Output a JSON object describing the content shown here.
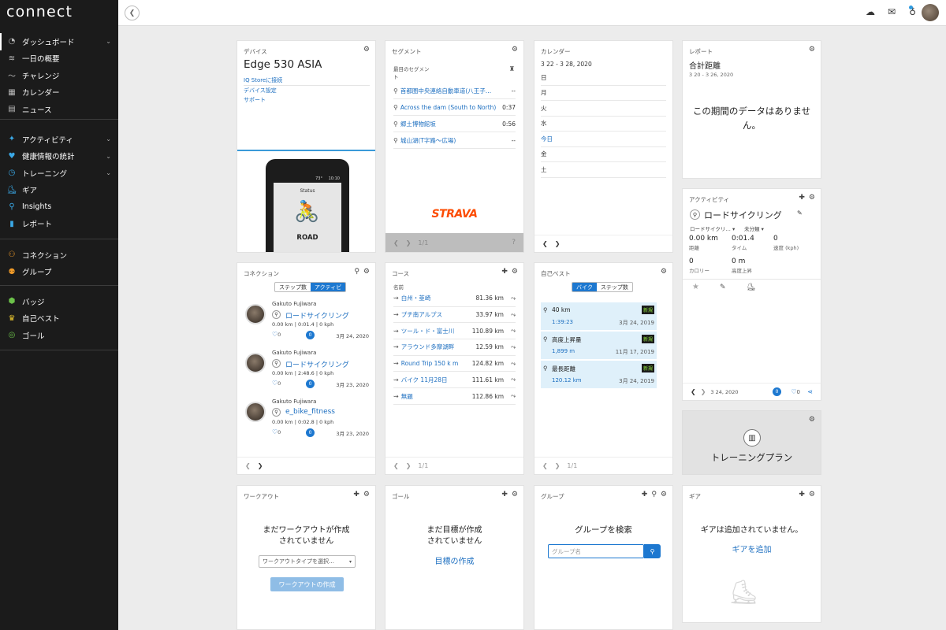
{
  "app": {
    "logo": "connect"
  },
  "sidebar": {
    "group1": [
      {
        "label": "ダッシュボード",
        "icon": "dashboard-icon",
        "glyph": "◔",
        "chevron": true
      },
      {
        "label": "一日の概要",
        "icon": "layers-icon",
        "glyph": "≋",
        "chevron": false
      },
      {
        "label": "チャレンジ",
        "icon": "challenge-icon",
        "glyph": "〜",
        "chevron": false
      },
      {
        "label": "カレンダー",
        "icon": "calendar-icon",
        "glyph": "▦",
        "chevron": false
      },
      {
        "label": "ニュース",
        "icon": "news-icon",
        "glyph": "▤",
        "chevron": false
      }
    ],
    "group2": [
      {
        "label": "アクティビティ",
        "icon": "activity-icon",
        "glyph": "✦",
        "chevron": true,
        "color": "blue"
      },
      {
        "label": "健康情報の統計",
        "icon": "heart-icon",
        "glyph": "♥",
        "chevron": true,
        "color": "blue"
      },
      {
        "label": "トレーニング",
        "icon": "stopwatch-icon",
        "glyph": "◷",
        "chevron": true,
        "color": "blue"
      },
      {
        "label": "ギア",
        "icon": "shoe-icon",
        "glyph": "⛸",
        "chevron": false,
        "color": "blue"
      },
      {
        "label": "Insights",
        "icon": "bulb-icon",
        "glyph": "⚲",
        "chevron": false,
        "color": "blue"
      },
      {
        "label": "レポート",
        "icon": "bar-chart-icon",
        "glyph": "▮",
        "chevron": false,
        "color": "blue"
      }
    ],
    "group3": [
      {
        "label": "コネクション",
        "icon": "connections-icon",
        "glyph": "⚇",
        "color": "orange"
      },
      {
        "label": "グループ",
        "icon": "group-icon",
        "glyph": "⚉",
        "color": "orange"
      }
    ],
    "group4": [
      {
        "label": "バッジ",
        "icon": "badge-icon",
        "glyph": "⬢",
        "color": "green"
      },
      {
        "label": "自己ベスト",
        "icon": "trophy-icon",
        "glyph": "♛",
        "color": "yellow"
      },
      {
        "label": "ゴール",
        "icon": "goal-icon",
        "glyph": "◎",
        "color": "green"
      }
    ]
  },
  "device": {
    "title": "デバイス",
    "name": "Edge 530 ASIA",
    "links": [
      "IQ Storeに接続",
      "デバイス設定",
      "サポート"
    ],
    "screen_status": "Status",
    "screen_mode": "ROAD",
    "screen_time": "10:10",
    "screen_temp": "73°"
  },
  "segments": {
    "title": "セグメント",
    "header": "最目のセグメント",
    "rows": [
      {
        "name": "首都圏中央連絡自動車道(八王子…",
        "val": "--"
      },
      {
        "name": "Across the dam (South to North)",
        "val": "0:37"
      },
      {
        "name": "郷土博物館坂",
        "val": "0:56"
      },
      {
        "name": "城山湖(T字路～広場)",
        "val": "--"
      }
    ],
    "brand": "STRAVA",
    "page": "1/1"
  },
  "calendar": {
    "title": "カレンダー",
    "range": "3 22 - 3 28, 2020",
    "days": [
      "日",
      "月",
      "火",
      "水",
      "今日",
      "金",
      "土"
    ]
  },
  "report": {
    "title": "レポート",
    "metric": "合計距離",
    "range": "3 20 - 3 26, 2020",
    "empty": "この期間のデータはありません。"
  },
  "activity": {
    "title": "アクティビティ",
    "name": "ロードサイクリング",
    "type": "ロードサイクリ…",
    "category": "未分類",
    "metrics": [
      {
        "val": "0.00 km",
        "lab": "距離"
      },
      {
        "val": "0:01.4",
        "lab": "タイム"
      },
      {
        "val": "0",
        "lab": "速度 (kph)"
      },
      {
        "val": "0",
        "lab": "カロリー"
      },
      {
        "val": "0 m",
        "lab": "高度上昇"
      }
    ],
    "date": "3 24, 2020",
    "comments": "0",
    "likes": "0"
  },
  "training_plan": {
    "label": "トレーニングプラン"
  },
  "connections": {
    "title": "コネクション",
    "toggle": [
      "ステップ数",
      "アクティビ"
    ],
    "items": [
      {
        "user": "Gakuto Fujiwara",
        "activity": "ロードサイクリング",
        "stats": "0.00 km | 0:01.4 | 0 kph",
        "likes": "0",
        "comments": "0",
        "date": "3月 24, 2020"
      },
      {
        "user": "Gakuto Fujiwara",
        "activity": "ロードサイクリング",
        "stats": "0.00 km | 2:48.6 | 0 kph",
        "likes": "0",
        "comments": "0",
        "date": "3月 23, 2020"
      },
      {
        "user": "Gakuto Fujiwara",
        "activity": "e_bike_fitness",
        "stats": "0.00 km | 0:02.8 | 0 kph",
        "likes": "0",
        "comments": "0",
        "date": "3月 23, 2020"
      }
    ]
  },
  "courses": {
    "title": "コース",
    "col": "名前",
    "rows": [
      {
        "name": "白州・韮崎",
        "dist": "81.36 km"
      },
      {
        "name": "プチ南アルプス",
        "dist": "33.97 km"
      },
      {
        "name": "ツール・ド・富士川",
        "dist": "110.89 km"
      },
      {
        "name": "アラウンド多摩湖畔",
        "dist": "12.59 km"
      },
      {
        "name": "Round Trip 150 k m",
        "dist": "124.82 km"
      },
      {
        "name": "バイク 11月28日",
        "dist": "111.61 km"
      },
      {
        "name": "無題",
        "dist": "112.86 km"
      }
    ],
    "page": "1/1"
  },
  "pb": {
    "title": "自己ベスト",
    "toggle": [
      "バイク",
      "ステップ数"
    ],
    "items": [
      {
        "name": "40 km",
        "val": "1:39:23",
        "date": "3月 24, 2019",
        "badge": "新規"
      },
      {
        "name": "高度上昇量",
        "val": "1,899 m",
        "date": "11月 17, 2019",
        "badge": "新規"
      },
      {
        "name": "最長距離",
        "val": "120.12 km",
        "date": "3月 24, 2019",
        "badge": "新規"
      }
    ],
    "page": "1/1"
  },
  "workout": {
    "title": "ワークアウト",
    "empty1": "まだワークアウトが作成",
    "empty2": "されていません",
    "select": "ワークアウトタイプを選択…",
    "btn": "ワークアウトの作成"
  },
  "goal": {
    "title": "ゴール",
    "empty1": "まだ目標が作成",
    "empty2": "されていません",
    "link": "目標の作成"
  },
  "group": {
    "title": "グループ",
    "heading": "グループを検索",
    "placeholder": "グループ名"
  },
  "gear": {
    "title": "ギア",
    "empty": "ギアは追加されていません。",
    "link": "ギアを追加"
  }
}
